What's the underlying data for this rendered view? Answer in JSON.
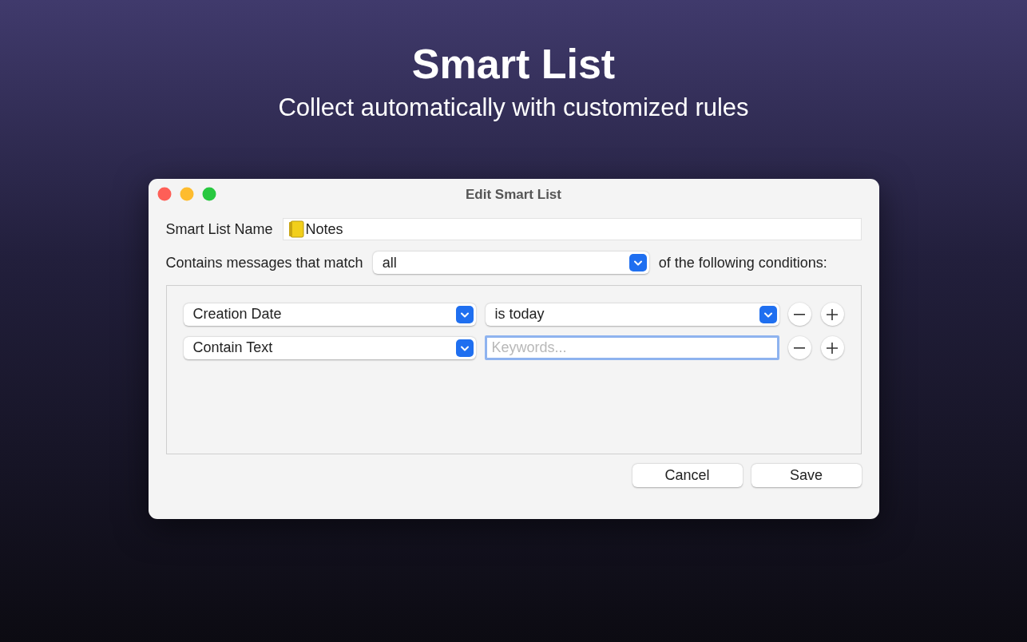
{
  "hero": {
    "title": "Smart List",
    "subtitle": "Collect automatically with customized rules"
  },
  "window": {
    "title": "Edit Smart List"
  },
  "name_field": {
    "label": "Smart List Name",
    "value": "Notes"
  },
  "match": {
    "label": "Contains messages that match",
    "value": "all",
    "suffix": "of the following conditions:"
  },
  "conditions": [
    {
      "field": "Creation Date",
      "operator": {
        "kind": "popup",
        "value": "is today"
      }
    },
    {
      "field": "Contain Text",
      "operator": {
        "kind": "text",
        "placeholder": "Keywords...",
        "focused": true
      }
    }
  ],
  "buttons": [
    "Cancel",
    "Save"
  ]
}
